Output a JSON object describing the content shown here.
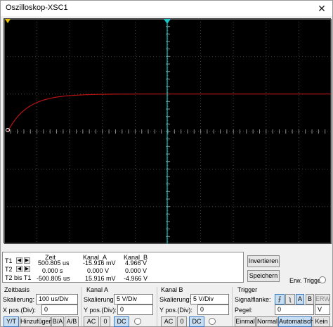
{
  "window": {
    "title": "Oszilloskop-XSC1",
    "close_glyph": "✕"
  },
  "screen": {
    "background": "#000000",
    "grid_color": "#444444",
    "trace_color": "#b81414",
    "cursor_color": "#18c8c8",
    "marker_color": "#e8c000"
  },
  "readout": {
    "headers": {
      "zeit": "Zeit",
      "kanal_a": "Kanal_A",
      "kanal_b": "Kanal_B"
    },
    "rows": [
      {
        "label": "T1",
        "zeit": "500.805 us",
        "kanal_a": "-15.916 mV",
        "kanal_b": "4.966 V"
      },
      {
        "label": "T2",
        "zeit": "0.000 s",
        "kanal_a": "0.000 V",
        "kanal_b": "0.000 V"
      },
      {
        "label": "T2 bis T1",
        "zeit": "-500.805 us",
        "kanal_a": "15.916 mV",
        "kanal_b": "-4.966 V"
      }
    ]
  },
  "buttons": {
    "invert": "Invertieren",
    "save": "Speichern",
    "ext_trigger": "Erw. Trigger"
  },
  "zeitbasis": {
    "title": "Zeitbasis",
    "scale_label": "Skalierung:",
    "scale_value": "100 us/Div",
    "xpos_label": "X pos.(Div):",
    "xpos_value": "0",
    "modes": [
      "Y/T",
      "Hinzufügen",
      "B/A",
      "A/B"
    ]
  },
  "kanal_a": {
    "title": "Kanal A",
    "scale_label": "Skalierung:",
    "scale_value": "5 V/Div",
    "ypos_label": "Y pos.(Div):",
    "ypos_value": "0",
    "coupling": [
      "AC",
      "0",
      "DC"
    ]
  },
  "kanal_b": {
    "title": "Kanal B",
    "scale_label": "Skalierung:",
    "scale_value": "5 V/Div",
    "ypos_label": "Y pos.(Div):",
    "ypos_value": "0",
    "coupling": [
      "AC",
      "0",
      "DC"
    ]
  },
  "trigger": {
    "title": "Trigger",
    "edge_label": "Signalflanke:",
    "edge_buttons": [
      "A",
      "B",
      "ERW"
    ],
    "level_label": "Pegel:",
    "level_value": "0",
    "level_unit": "V",
    "modes": [
      "Einmal",
      "Normal",
      "Automatisch",
      "Kein"
    ]
  }
}
